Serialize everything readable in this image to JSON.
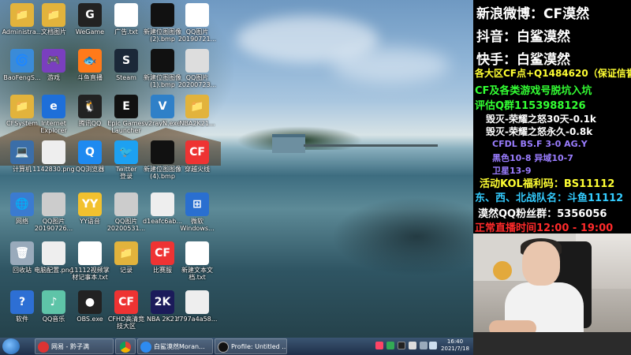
{
  "desktop": {
    "icons": [
      {
        "label": "Administra...",
        "glyph": "📁"
      },
      {
        "label": "文档图片",
        "glyph": "📁"
      },
      {
        "label": "WeGame",
        "glyph": "G"
      },
      {
        "label": "广告.txt",
        "glyph": ""
      },
      {
        "label": "新建位图图像\n(2).bmp",
        "glyph": ""
      },
      {
        "label": "QQ图片\n20190721...",
        "glyph": ""
      },
      {
        "label": "BaoFengS...",
        "glyph": "🌀"
      },
      {
        "label": "游戏",
        "glyph": "🎮"
      },
      {
        "label": "斗鱼直播",
        "glyph": "🐟"
      },
      {
        "label": "Steam",
        "glyph": "S"
      },
      {
        "label": "新建位图图像\n(1).bmp",
        "glyph": ""
      },
      {
        "label": "QQ图片\n20200723...",
        "glyph": ""
      },
      {
        "label": "CFSystem",
        "glyph": "📁"
      },
      {
        "label": "Internet\nExplorer",
        "glyph": "e"
      },
      {
        "label": "腾讯QQ",
        "glyph": "🐧"
      },
      {
        "label": "Epic Games\nLauncher",
        "glyph": "E"
      },
      {
        "label": "v2rayN.exe",
        "glyph": "V"
      },
      {
        "label": "NBA2K21...",
        "glyph": "📁"
      },
      {
        "label": "计算机",
        "glyph": "💻"
      },
      {
        "label": "1142830.png",
        "glyph": ""
      },
      {
        "label": "QQ浏览器",
        "glyph": "Q"
      },
      {
        "label": "Twitter\n登录",
        "glyph": "🐦"
      },
      {
        "label": "新建位图图像\n(4).bmp",
        "glyph": ""
      },
      {
        "label": "穿越火线",
        "glyph": "CF"
      },
      {
        "label": "网络",
        "glyph": "🌐"
      },
      {
        "label": "QQ图片\n20190726...",
        "glyph": ""
      },
      {
        "label": "YY语音",
        "glyph": "YY"
      },
      {
        "label": "QQ图片\n20200531...",
        "glyph": ""
      },
      {
        "label": "d1eafc6ab...",
        "glyph": ""
      },
      {
        "label": "微软\nWindows...",
        "glyph": "⊞"
      },
      {
        "label": "回收站",
        "glyph": "🗑"
      },
      {
        "label": "电脑配置.png",
        "glyph": ""
      },
      {
        "label": "11112视频掌\n材记事本.txt",
        "glyph": ""
      },
      {
        "label": "记录",
        "glyph": "📁"
      },
      {
        "label": "比赛服",
        "glyph": "CF"
      },
      {
        "label": "新建文本文\n档.txt",
        "glyph": ""
      },
      {
        "label": "软件",
        "glyph": "?"
      },
      {
        "label": "QQ音乐",
        "glyph": "♪"
      },
      {
        "label": "OBS.exe",
        "glyph": "●"
      },
      {
        "label": "CFHD高清竞\n技大区",
        "glyph": "CF"
      },
      {
        "label": "NBA 2K21",
        "glyph": "2K"
      },
      {
        "label": "f797a4a58...",
        "glyph": ""
      }
    ]
  },
  "taskbar": {
    "buttons": [
      {
        "label": "网易 - 黔子满"
      },
      {
        "label": ""
      },
      {
        "label": "白鲨漠然Moran..."
      },
      {
        "label": "Profile: Untitled ..."
      }
    ],
    "clock_time": "16:40",
    "clock_date": "2021/7/18"
  },
  "overlay": {
    "lines": [
      {
        "text": "新浪微博：CF漠然",
        "color": "#ffffff"
      },
      {
        "text": "抖音：白鲨漠然",
        "color": "#ffffff"
      },
      {
        "text": "快手：白鲨漠然",
        "color": "#ffffff"
      },
      {
        "text": "各大区CF点+Q1484620（保证信誉）",
        "color": "#ffff33"
      },
      {
        "text": "CF及各类游戏号脱坑入坑",
        "color": "#33ff33"
      },
      {
        "text": "评估Q群1153988126",
        "color": "#33ff33"
      },
      {
        "text": "毁灭-荣耀之怒30天-0.1k",
        "color": "#ffffff"
      },
      {
        "text": "毁灭-荣耀之怒永久-0.8k",
        "color": "#ffffff"
      },
      {
        "text": "CFDL BS.F 3-0 AG.Y",
        "color": "#9a7dff"
      },
      {
        "text": "黑色10-8 异域10-7",
        "color": "#9a7dff"
      },
      {
        "text": "卫星13-9",
        "color": "#9a7dff"
      },
      {
        "text": "活动KOL福利码：BS11112",
        "color": "#ffff33"
      },
      {
        "text": "东、西、北战队名：斗鱼11112",
        "color": "#33ccff"
      },
      {
        "text": "漠然QQ粉丝群：5356056",
        "color": "#ffffff"
      },
      {
        "text": "正常直播时间12:00 - 19:00",
        "color": "#ff2a2a"
      }
    ]
  }
}
